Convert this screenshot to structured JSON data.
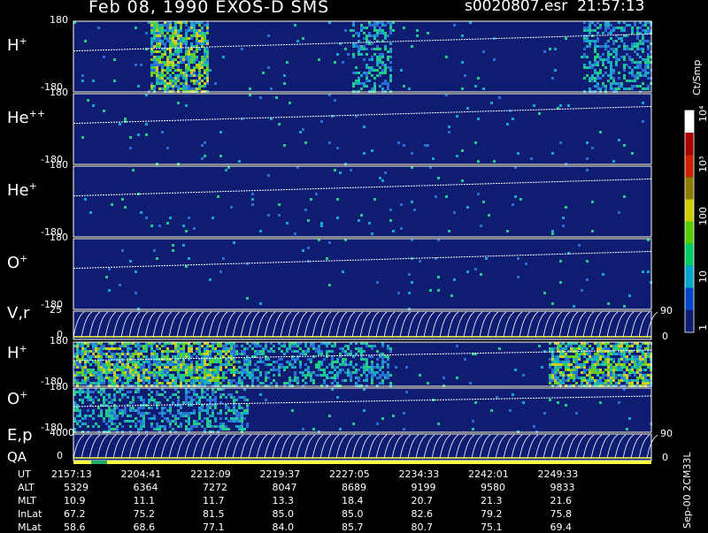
{
  "header": {
    "title": "Feb 08, 1990   EXOS-D SMS",
    "file": "s0020807.esr",
    "time": "21:57:13"
  },
  "panels": [
    {
      "id": "h_plus",
      "label": "H",
      "sup": "+",
      "ymax": "180",
      "ymin": "-180"
    },
    {
      "id": "he_plusplus",
      "label": "He",
      "sup": "++",
      "ymax": "180",
      "ymin": "-180"
    },
    {
      "id": "he_plus",
      "label": "He",
      "sup": "+",
      "ymax": "180",
      "ymin": "-180"
    },
    {
      "id": "o_plus",
      "label": "O",
      "sup": "+",
      "ymax": "180",
      "ymin": "-180"
    },
    {
      "id": "vr",
      "label": "V,r",
      "sup": "",
      "ymax": "25",
      "ymin": "0",
      "rmax": "90",
      "rmin": "0"
    },
    {
      "id": "h_plus_2",
      "label": "H",
      "sup": "+",
      "ymax": "180",
      "ymin": "-180"
    },
    {
      "id": "o_plus_2",
      "label": "O",
      "sup": "+",
      "ymax": "180",
      "ymin": "-180"
    },
    {
      "id": "ep",
      "label": "E,p",
      "sup": "",
      "ymax": "4000",
      "ymin": "0",
      "rmax": "90",
      "rmin": "0"
    }
  ],
  "qa_label": "QA",
  "colorbar": {
    "units": "Ct/Smp",
    "ticks": [
      "1",
      "10",
      "100",
      "10³",
      "10⁴"
    ],
    "colors": [
      "#0e1c72",
      "#0044cc",
      "#00a6cc",
      "#00cc66",
      "#55cc00",
      "#cccc00",
      "#8c7d00",
      "#cc2200",
      "#aa0000",
      "#ffffff"
    ]
  },
  "stamp": "Sep-00 2CM33L",
  "orbit_table": {
    "row_labels": [
      "UT",
      "ALT",
      "MLT",
      "InLat",
      "MLat"
    ],
    "columns": [
      [
        "2157:13",
        "5329",
        "10.9",
        "67.2",
        "58.6"
      ],
      [
        "2204:41",
        "6364",
        "11.1",
        "75.2",
        "68.6"
      ],
      [
        "2212:09",
        "7272",
        "11.7",
        "81.5",
        "77.1"
      ],
      [
        "2219:37",
        "8047",
        "13.3",
        "85.0",
        "84.0"
      ],
      [
        "2227:05",
        "8689",
        "18.4",
        "85.0",
        "85.7"
      ],
      [
        "2234:33",
        "9199",
        "20.7",
        "82.6",
        "80.7"
      ],
      [
        "2242:01",
        "9580",
        "21.3",
        "79.2",
        "75.1"
      ],
      [
        "2249:33",
        "9833",
        "21.6",
        "75.8",
        "69.4"
      ]
    ]
  },
  "chart_data": {
    "type": "heatmap",
    "title": "Feb 08, 1990   EXOS-D SMS",
    "x_ticks": [
      "2157:13",
      "2204:41",
      "2212:09",
      "2219:37",
      "2227:05",
      "2234:33",
      "2242:01",
      "2249:33"
    ],
    "colorbar_ticks": [
      "1",
      "10",
      "100",
      "10³",
      "10⁴"
    ],
    "colorbar_label": "Ct/Smp",
    "activity_regions": [
      {
        "panel": "h_plus",
        "from": 0.13,
        "to": 0.23,
        "level": "high"
      },
      {
        "panel": "h_plus",
        "from": 0.48,
        "to": 0.55,
        "level": "medium"
      },
      {
        "panel": "h_plus",
        "from": 0.88,
        "to": 1.0,
        "level": "medium"
      },
      {
        "panel": "h_plus_2",
        "from": 0.0,
        "to": 0.28,
        "level": "high"
      },
      {
        "panel": "h_plus_2",
        "from": 0.28,
        "to": 0.55,
        "level": "medium"
      },
      {
        "panel": "h_plus_2",
        "from": 0.82,
        "to": 1.0,
        "level": "high"
      },
      {
        "panel": "o_plus_2",
        "from": 0.0,
        "to": 0.3,
        "level": "medium"
      }
    ]
  }
}
